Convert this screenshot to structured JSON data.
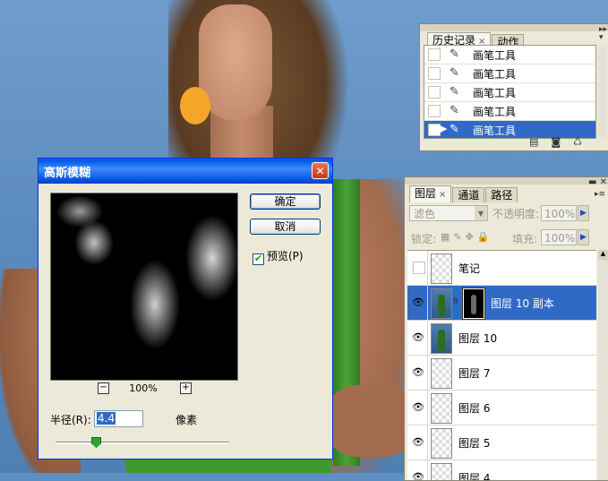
{
  "history_panel": {
    "tabs": [
      {
        "label": "历史记录",
        "close": "×"
      },
      {
        "label": "动作"
      }
    ],
    "items": [
      {
        "label": "画笔工具"
      },
      {
        "label": "画笔工具"
      },
      {
        "label": "画笔工具"
      },
      {
        "label": "画笔工具"
      },
      {
        "label": "画笔工具",
        "selected": true
      }
    ]
  },
  "layers_panel": {
    "tabs": [
      {
        "label": "图层",
        "close": "×"
      },
      {
        "label": "通道"
      },
      {
        "label": "路径"
      }
    ],
    "blend_mode": "滤色",
    "opacity_label": "不透明度:",
    "opacity_value": "100%",
    "lock_label": "锁定:",
    "fill_label": "填充:",
    "fill_value": "100%",
    "layers": [
      {
        "name": "笔记",
        "visible": false
      },
      {
        "name": "图层 10 副本",
        "visible": true,
        "selected": true,
        "has_mask": true
      },
      {
        "name": "图层 10",
        "visible": true
      },
      {
        "name": "图层 7",
        "visible": true
      },
      {
        "name": "图层 6",
        "visible": true
      },
      {
        "name": "图层 5",
        "visible": true
      },
      {
        "name": "图层 4",
        "visible": true
      }
    ]
  },
  "gaussian_blur_dialog": {
    "title": "高斯模糊",
    "ok_label": "确定",
    "cancel_label": "取消",
    "preview_label": "预览(P)",
    "preview_checked": true,
    "zoom_value": "100%",
    "zoom_out_icon": "−",
    "zoom_in_icon": "+",
    "radius_label": "半径(R):",
    "radius_value": "4.4",
    "radius_unit": "像素"
  }
}
